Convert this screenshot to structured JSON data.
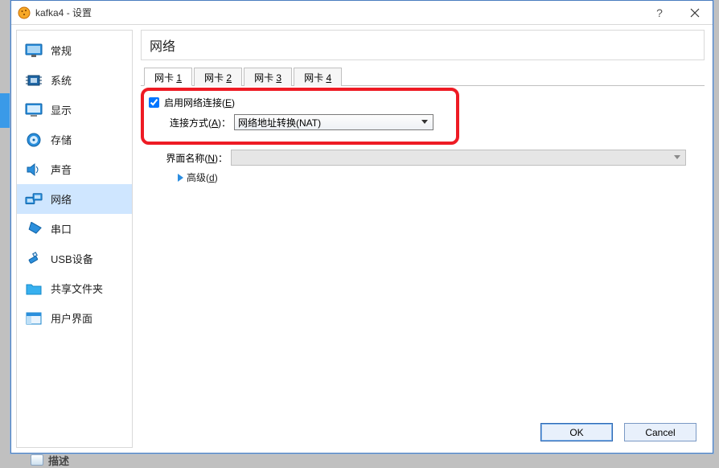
{
  "titlebar": {
    "title": "kafka4 - 设置"
  },
  "sidebar": {
    "items": [
      {
        "label": "常规",
        "icon": "monitor"
      },
      {
        "label": "系统",
        "icon": "chip"
      },
      {
        "label": "显示",
        "icon": "display"
      },
      {
        "label": "存储",
        "icon": "disk"
      },
      {
        "label": "声音",
        "icon": "speaker"
      },
      {
        "label": "网络",
        "icon": "network"
      },
      {
        "label": "串口",
        "icon": "serial"
      },
      {
        "label": "USB设备",
        "icon": "usb"
      },
      {
        "label": "共享文件夹",
        "icon": "folder"
      },
      {
        "label": "用户界面",
        "icon": "ui"
      }
    ]
  },
  "section": {
    "title": "网络"
  },
  "tabs": [
    {
      "label": "网卡 ",
      "digit": "1"
    },
    {
      "label": "网卡 ",
      "digit": "2"
    },
    {
      "label": "网卡 ",
      "digit": "3"
    },
    {
      "label": "网卡 ",
      "digit": "4"
    }
  ],
  "form": {
    "enable_label_a": "启用网络连接(",
    "enable_label_u": "E",
    "enable_label_b": ")",
    "attach_label_a": "连接方式(",
    "attach_label_u": "A",
    "attach_label_b": ")：",
    "attach_value": "网络地址转换(NAT)",
    "name_label_a": "界面名称(",
    "name_label_u": "N",
    "name_label_b": ")：",
    "name_value": "",
    "advanced_a": "高级(",
    "advanced_u": "d",
    "advanced_b": ")"
  },
  "buttons": {
    "ok": "OK",
    "cancel": "Cancel"
  },
  "bottom": {
    "label": "描述"
  }
}
